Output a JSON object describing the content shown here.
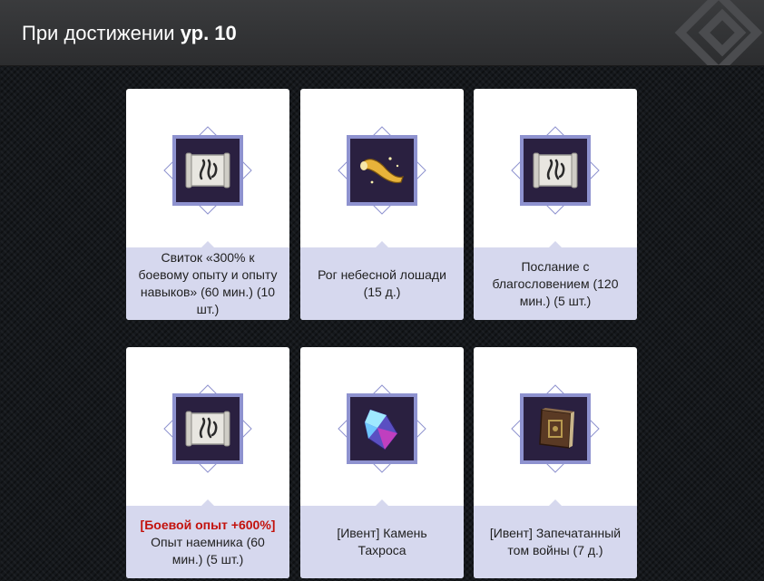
{
  "header": {
    "title_prefix": "При достижении",
    "title_level": "ур. 10"
  },
  "items": [
    {
      "name": "Свиток «300% к боевому опыту и опыту навыков» (60 мин.) (10 шт.)",
      "highlight": "",
      "icon": "scroll-icon"
    },
    {
      "name": "Рог небесной лошади (15 д.)",
      "highlight": "",
      "icon": "horn-icon"
    },
    {
      "name": "Послание с благословением (120 мин.) (5 шт.)",
      "highlight": "",
      "icon": "scroll-icon"
    },
    {
      "name": "Опыт наемника (60 мин.) (5 шт.)",
      "highlight": "[Боевой опыт +600%]",
      "icon": "scroll-icon"
    },
    {
      "name": "[Ивент] Камень Тахроса",
      "highlight": "",
      "icon": "crystal-icon"
    },
    {
      "name": "[Ивент] Запечатанный том войны (7 д.)",
      "highlight": "",
      "icon": "tome-icon"
    }
  ],
  "colors": {
    "frame": "#8e92cf",
    "caption_bg": "#d6d8ee",
    "highlight": "#c3120c"
  }
}
